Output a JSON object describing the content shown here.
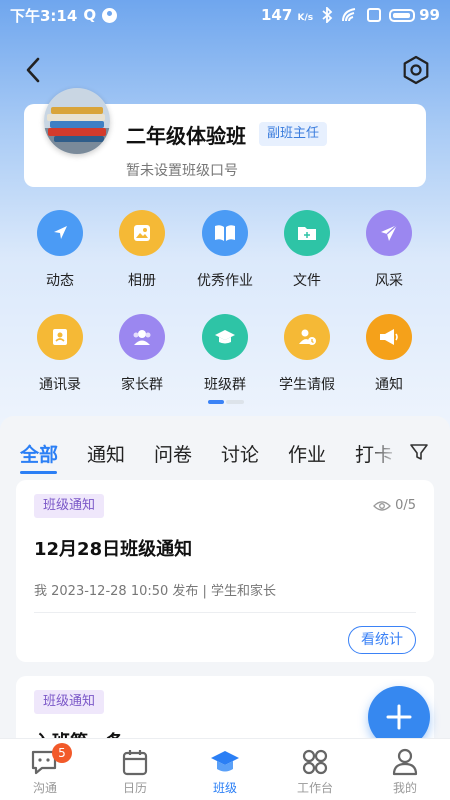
{
  "status_bar": {
    "time": "下午3:14",
    "q_glyph": "Q",
    "speed": "147",
    "speed_unit": "K/s",
    "battery": "99"
  },
  "header": {
    "class_name": "二年级体验班",
    "role": "副班主任",
    "slogan": "暂未设置班级口号"
  },
  "features": [
    {
      "label": "动态",
      "icon": "compass-icon",
      "color": "#4b9bf5"
    },
    {
      "label": "相册",
      "icon": "photo-icon",
      "color": "#f5b936"
    },
    {
      "label": "优秀作业",
      "icon": "book-icon",
      "color": "#4b9bf5"
    },
    {
      "label": "文件",
      "icon": "folder-icon",
      "color": "#2ec4a6"
    },
    {
      "label": "风采",
      "icon": "paper-plane-icon",
      "color": "#9b87f0"
    },
    {
      "label": "通讯录",
      "icon": "contacts-icon",
      "color": "#f5b936"
    },
    {
      "label": "家长群",
      "icon": "parents-group-icon",
      "color": "#9b87f0"
    },
    {
      "label": "班级群",
      "icon": "graduation-cap-icon",
      "color": "#2ec4a6"
    },
    {
      "label": "学生请假",
      "icon": "student-leave-icon",
      "color": "#f5b936"
    },
    {
      "label": "通知",
      "icon": "megaphone-icon",
      "color": "#f5a11a"
    }
  ],
  "tabs": [
    "全部",
    "通知",
    "问卷",
    "讨论",
    "作业",
    "打卡"
  ],
  "posts": [
    {
      "badge": "班级通知",
      "read": "0/5",
      "title": "12月28日班级通知",
      "meta": "我   2023-12-28 10:50 发布    | 学生和家长",
      "action": "看统计"
    },
    {
      "badge": "班级通知",
      "title": "入班第一条"
    }
  ],
  "bottom_nav": [
    {
      "label": "沟通",
      "icon": "chat-icon",
      "badge": "5"
    },
    {
      "label": "日历",
      "icon": "calendar-icon"
    },
    {
      "label": "班级",
      "icon": "class-hat-icon"
    },
    {
      "label": "工作台",
      "icon": "workbench-icon"
    },
    {
      "label": "我的",
      "icon": "profile-icon"
    }
  ]
}
